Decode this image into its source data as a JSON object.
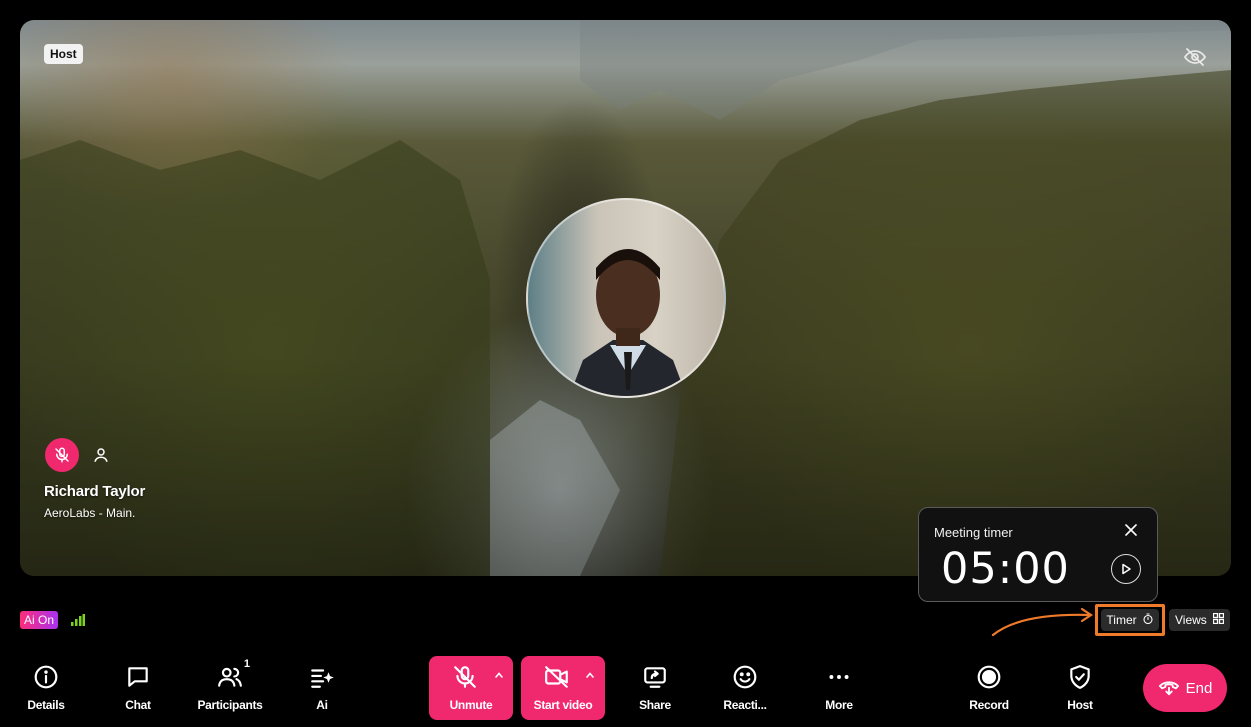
{
  "stage": {
    "host_badge": "Host",
    "participant": {
      "name": "Richard Taylor",
      "org": "AeroLabs - Main."
    }
  },
  "timer_card": {
    "title": "Meeting timer",
    "value": "05:00"
  },
  "status": {
    "ai_label": "Ai On"
  },
  "controls": {
    "timer_label": "Timer",
    "views_label": "Views"
  },
  "toolbar": {
    "details": "Details",
    "chat": "Chat",
    "participants": "Participants",
    "participants_count": "1",
    "ai": "Ai",
    "unmute": "Unmute",
    "start_video": "Start video",
    "share": "Share",
    "reactions": "Reacti...",
    "more": "More",
    "record": "Record",
    "host": "Host",
    "end": "End"
  },
  "colors": {
    "accent": "#f0286e",
    "highlight": "#ef7b2a",
    "signal": "#7ed321"
  }
}
